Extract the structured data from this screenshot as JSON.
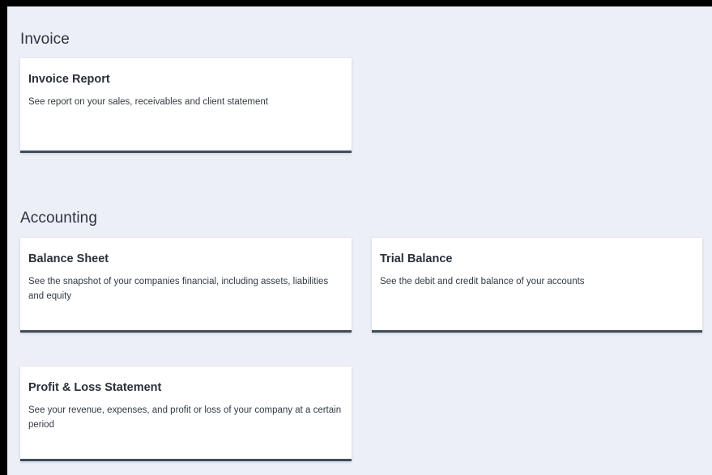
{
  "sections": {
    "invoice": {
      "title": "Invoice",
      "cards": [
        {
          "title": "Invoice Report",
          "description": "See report on your sales, receivables and client statement"
        }
      ]
    },
    "accounting": {
      "title": "Accounting",
      "cards": [
        {
          "title": "Balance Sheet",
          "description": "See the snapshot of your companies financial, including assets, liabilities and equity"
        },
        {
          "title": "Trial Balance",
          "description": "See the debit and credit balance of your accounts"
        },
        {
          "title": "Profit & Loss Statement",
          "description": "See your revenue, expenses, and profit or loss of your company at a certain period"
        }
      ]
    }
  },
  "colors": {
    "background": "#eceff6",
    "card": "#ffffff",
    "card_accent_border": "#3f4c5a",
    "outer_frame": "#000000"
  }
}
